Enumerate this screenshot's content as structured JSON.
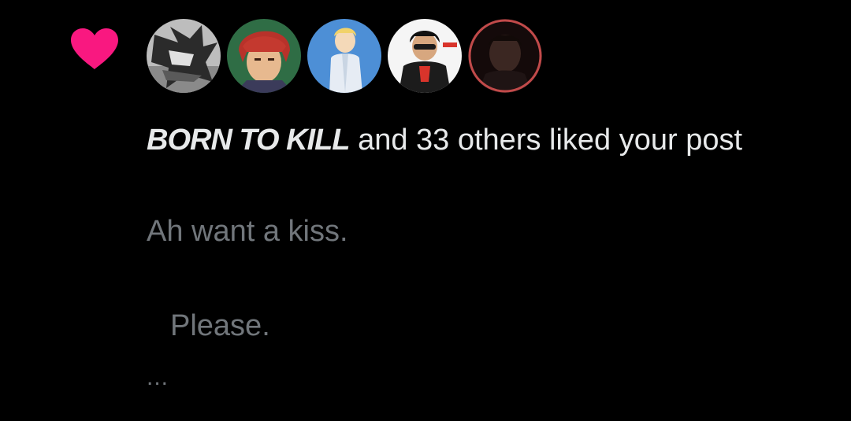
{
  "notification": {
    "type_icon": "heart-icon",
    "accent_color": "#f91880",
    "avatars": [
      {
        "name": "avatar-1",
        "palette": [
          "#bfbfbf",
          "#3a3a3a"
        ]
      },
      {
        "name": "avatar-2",
        "palette": [
          "#2e7d4f",
          "#c0392b"
        ]
      },
      {
        "name": "avatar-3",
        "palette": [
          "#4a90d9",
          "#f2d36b"
        ]
      },
      {
        "name": "avatar-4",
        "palette": [
          "#f2f2f2",
          "#1a1a1a"
        ]
      },
      {
        "name": "avatar-5",
        "palette": [
          "#1a0d0d",
          "#c14a4a"
        ]
      }
    ],
    "actor_name": "BORN TO KILL",
    "action_text": " and 33 others liked your post",
    "post_line_1": "Ah want a kiss.",
    "post_line_2": "Please.",
    "ellipsis": "..."
  }
}
